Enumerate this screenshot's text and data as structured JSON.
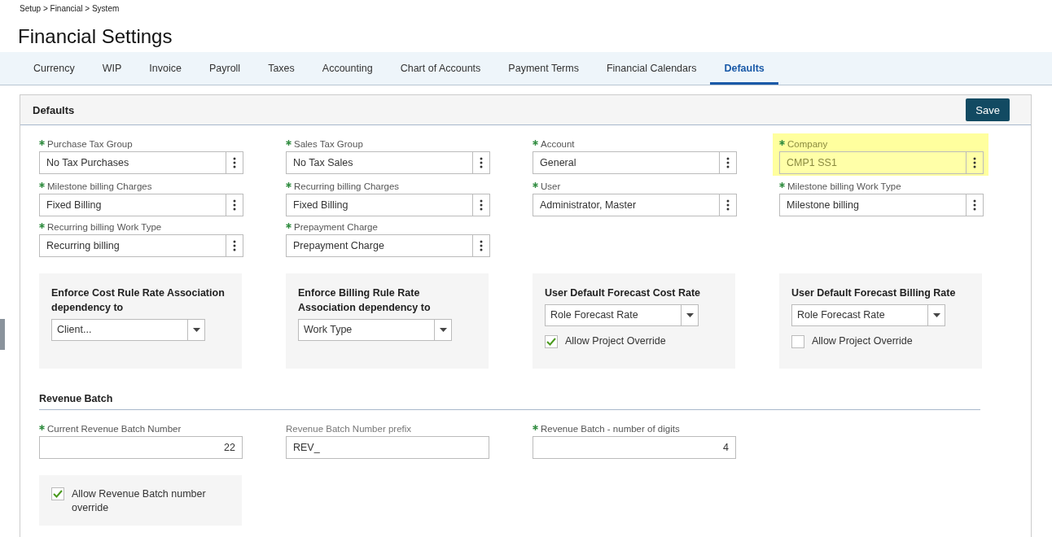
{
  "breadcrumb": "Setup > Financial > System",
  "title": "Financial Settings",
  "tabs": [
    {
      "label": "Currency",
      "selected": false
    },
    {
      "label": "WIP",
      "selected": false
    },
    {
      "label": "Invoice",
      "selected": false
    },
    {
      "label": "Payroll",
      "selected": false
    },
    {
      "label": "Taxes",
      "selected": false
    },
    {
      "label": "Accounting",
      "selected": false
    },
    {
      "label": "Chart of Accounts",
      "selected": false
    },
    {
      "label": "Payment Terms",
      "selected": false
    },
    {
      "label": "Financial Calendars",
      "selected": false
    },
    {
      "label": "Defaults",
      "selected": true
    }
  ],
  "panel": {
    "title": "Defaults",
    "save_button": "Save",
    "lookup_fields": [
      {
        "label": "Purchase Tax Group",
        "value": "No Tax Purchases",
        "required": true,
        "highlighted": false
      },
      {
        "label": "Sales Tax Group",
        "value": "No Tax Sales",
        "required": true,
        "highlighted": false
      },
      {
        "label": "Account",
        "value": "General",
        "required": true,
        "highlighted": false
      },
      {
        "label": "Company",
        "value": "CMP1 SS1",
        "required": true,
        "highlighted": true
      },
      {
        "label": "Milestone billing Charges",
        "value": "Fixed Billing",
        "required": true,
        "highlighted": false
      },
      {
        "label": "Recurring billing Charges",
        "value": "Fixed Billing",
        "required": true,
        "highlighted": false
      },
      {
        "label": "User",
        "value": "Administrator, Master",
        "required": true,
        "highlighted": false
      },
      {
        "label": "Milestone billing Work Type",
        "value": "Milestone billing",
        "required": true,
        "highlighted": false
      },
      {
        "label": "Recurring billing Work Type",
        "value": "Recurring billing",
        "required": true,
        "highlighted": false
      },
      {
        "label": "Prepayment Charge",
        "value": "Prepayment Charge",
        "required": true,
        "highlighted": false
      }
    ],
    "rate_boxes": [
      {
        "title": "Enforce Cost Rule Rate Association dependency to",
        "value": "Client..."
      },
      {
        "title": "Enforce Billing Rule Rate Association dependency to",
        "value": "Work Type"
      },
      {
        "title": "User Default Forecast Cost Rate",
        "value": "Role Forecast Rate",
        "checkbox": {
          "label": "Allow Project Override",
          "checked": true
        }
      },
      {
        "title": "User Default Forecast Billing Rate",
        "value": "Role Forecast Rate",
        "checkbox": {
          "label": "Allow Project Override",
          "checked": false
        }
      }
    ],
    "revenue_batch": {
      "title": "Revenue Batch",
      "fields": [
        {
          "label": "Current Revenue Batch Number",
          "value": "22",
          "required": true,
          "kind": "number"
        },
        {
          "label": "Revenue Batch Number prefix",
          "value": "REV_",
          "required": false,
          "kind": "text"
        },
        {
          "label": "Revenue Batch - number of digits",
          "value": "4",
          "required": true,
          "kind": "number"
        }
      ],
      "override": {
        "label": "Allow Revenue Batch number override",
        "checked": true
      }
    }
  }
}
